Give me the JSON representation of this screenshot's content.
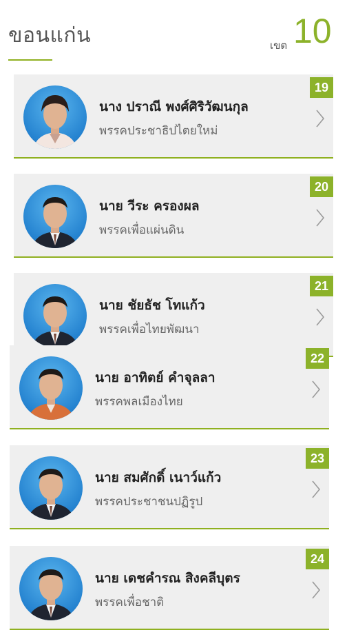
{
  "header": {
    "province": "ขอนแก่น",
    "district_label": "เขต",
    "district_number": "10"
  },
  "candidates": [
    {
      "number": "19",
      "name": "นาง ปราณี พงศ์ศิริวัฒนกุล",
      "party": "พรรคประชาธิปไตยใหม่",
      "attire": "female"
    },
    {
      "number": "20",
      "name": "นาย วีระ ครองผล",
      "party": "พรรคเพื่อแผ่นดิน",
      "attire": "suit"
    },
    {
      "number": "21",
      "name": "นาย ชัยธัช โทแก้ว",
      "party": "พรรคเพื่อไทยพัฒนา",
      "attire": "suit"
    },
    {
      "number": "22",
      "name": "นาย อาทิตย์ คำจุลลา",
      "party": "พรรคพลเมืองไทย",
      "attire": "orange"
    },
    {
      "number": "23",
      "name": "นาย สมศักดิ์ เนาว์แก้ว",
      "party": "พรรคประชาชนปฏิรูป",
      "attire": "suit"
    },
    {
      "number": "24",
      "name": "นาย เดชคำรณ สิงคลีบุตร",
      "party": "พรรคเพื่อชาติ",
      "attire": "suit"
    }
  ],
  "colors": {
    "accent": "#8cb22a",
    "card_bg": "#efefef",
    "photo_bg": "#2583d0"
  }
}
